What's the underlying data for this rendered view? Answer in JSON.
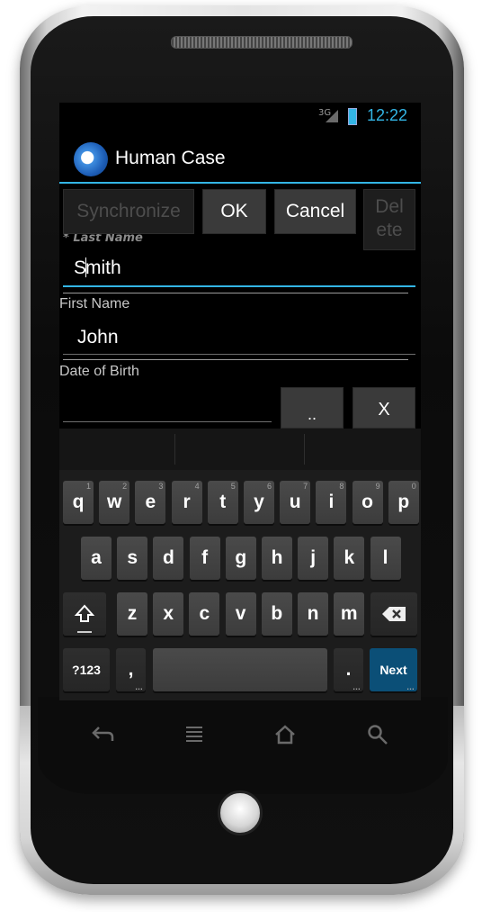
{
  "status": {
    "network": "3G",
    "time": "12:22"
  },
  "app": {
    "title": "Human Case"
  },
  "toolbar": {
    "synchronize": "Synchronize",
    "ok": "OK",
    "cancel": "Cancel",
    "delete_line1": "Del",
    "delete_line2": "ete"
  },
  "form": {
    "last_name_label": "* Last Name",
    "last_name_value_a": "S",
    "last_name_value_b": "mith",
    "first_name_label": "First Name",
    "first_name_value": "John",
    "dob_label": "Date of Birth",
    "dob_pick": "..",
    "dob_clear": "X"
  },
  "keyboard": {
    "row1": [
      "q",
      "w",
      "e",
      "r",
      "t",
      "y",
      "u",
      "i",
      "o",
      "p"
    ],
    "row1_nums": [
      "1",
      "2",
      "3",
      "4",
      "5",
      "6",
      "7",
      "8",
      "9",
      "0"
    ],
    "row2": [
      "a",
      "s",
      "d",
      "f",
      "g",
      "h",
      "j",
      "k",
      "l"
    ],
    "row3": [
      "z",
      "x",
      "c",
      "v",
      "b",
      "n",
      "m"
    ],
    "symbols": "?123",
    "comma": ",",
    "period": ".",
    "next": "Next"
  }
}
